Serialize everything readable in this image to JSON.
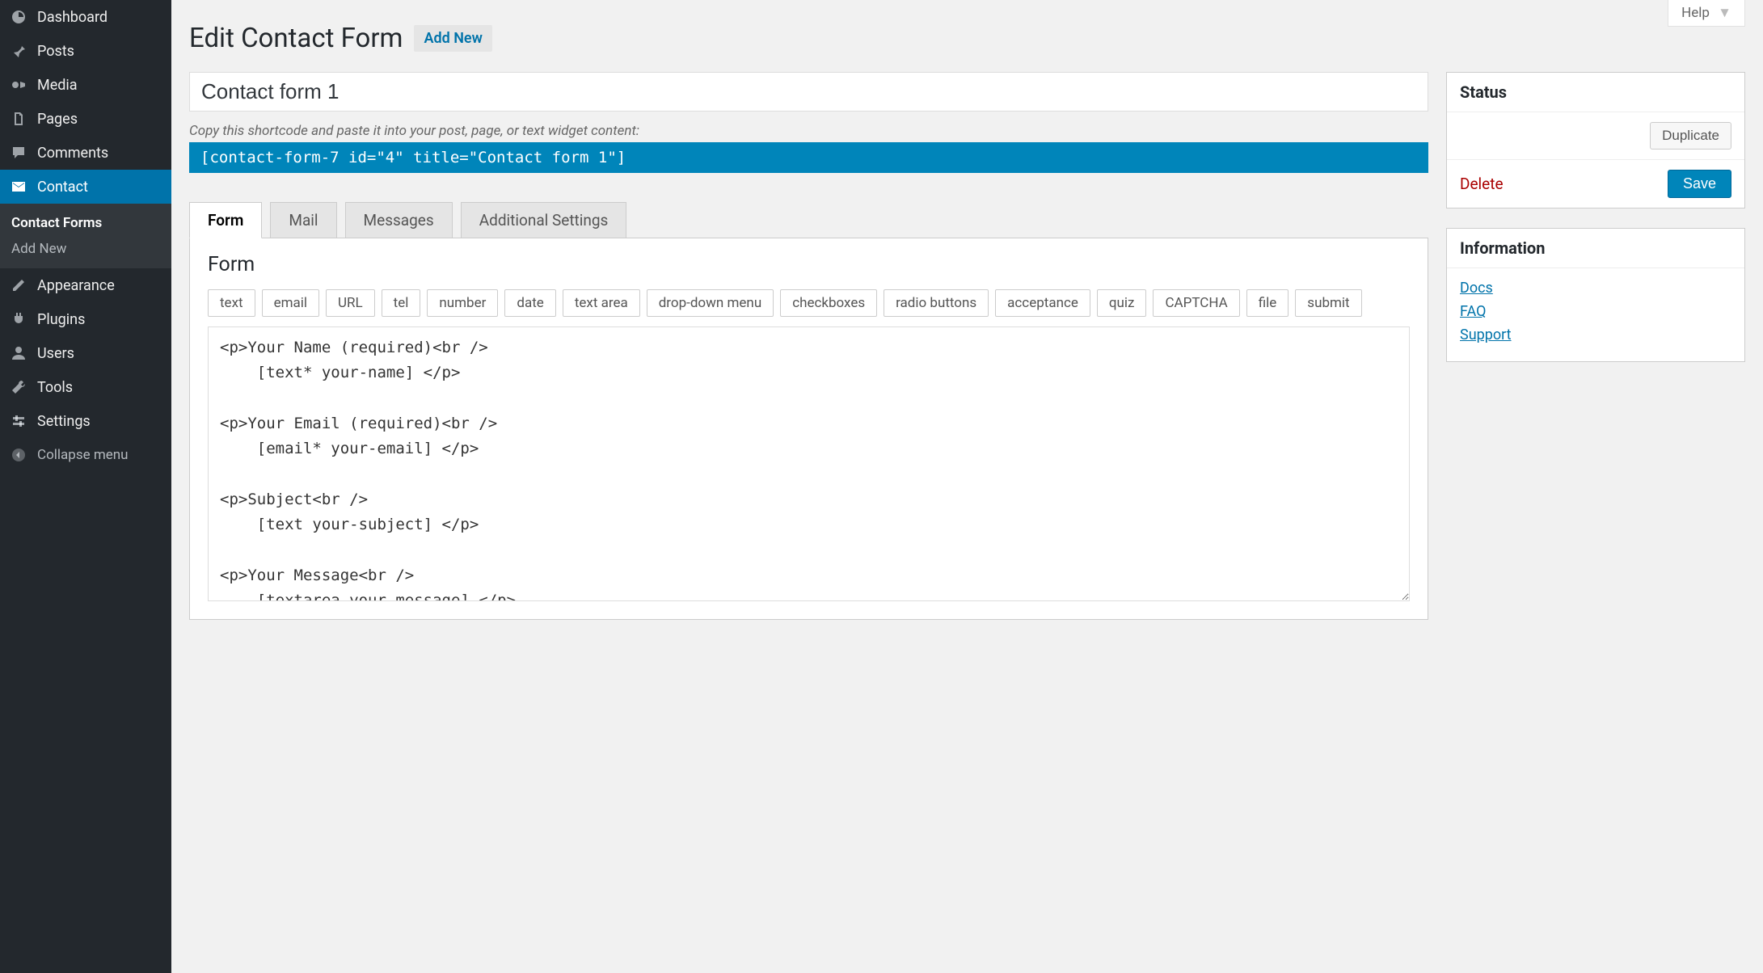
{
  "sidebar": {
    "items": [
      {
        "label": "Dashboard",
        "icon": "dashboard"
      },
      {
        "label": "Posts",
        "icon": "pin"
      },
      {
        "label": "Media",
        "icon": "media"
      },
      {
        "label": "Pages",
        "icon": "pages"
      },
      {
        "label": "Comments",
        "icon": "comments"
      },
      {
        "label": "Contact",
        "icon": "mail",
        "active": true
      },
      {
        "label": "Appearance",
        "icon": "appearance"
      },
      {
        "label": "Plugins",
        "icon": "plugins"
      },
      {
        "label": "Users",
        "icon": "users"
      },
      {
        "label": "Tools",
        "icon": "tools"
      },
      {
        "label": "Settings",
        "icon": "settings"
      }
    ],
    "sub": [
      "Contact Forms",
      "Add New"
    ],
    "collapse": "Collapse menu"
  },
  "help": "Help",
  "heading": "Edit Contact Form",
  "add_new": "Add New",
  "form_title": "Contact form 1",
  "shortcode_hint": "Copy this shortcode and paste it into your post, page, or text widget content:",
  "shortcode": "[contact-form-7 id=\"4\" title=\"Contact form 1\"]",
  "tabs": [
    "Form",
    "Mail",
    "Messages",
    "Additional Settings"
  ],
  "panel_title": "Form",
  "tag_buttons": [
    "text",
    "email",
    "URL",
    "tel",
    "number",
    "date",
    "text area",
    "drop-down menu",
    "checkboxes",
    "radio buttons",
    "acceptance",
    "quiz",
    "CAPTCHA",
    "file",
    "submit"
  ],
  "form_code": "<p>Your Name (required)<br />\n    [text* your-name] </p>\n\n<p>Your Email (required)<br />\n    [email* your-email] </p>\n\n<p>Subject<br />\n    [text your-subject] </p>\n\n<p>Your Message<br />\n    [textarea your-message] </p>\n\n<p>[submit \"Send\"]</p>",
  "meta": {
    "status_title": "Status",
    "duplicate": "Duplicate",
    "delete": "Delete",
    "save": "Save",
    "info_title": "Information",
    "links": [
      "Docs",
      "FAQ",
      "Support"
    ]
  }
}
